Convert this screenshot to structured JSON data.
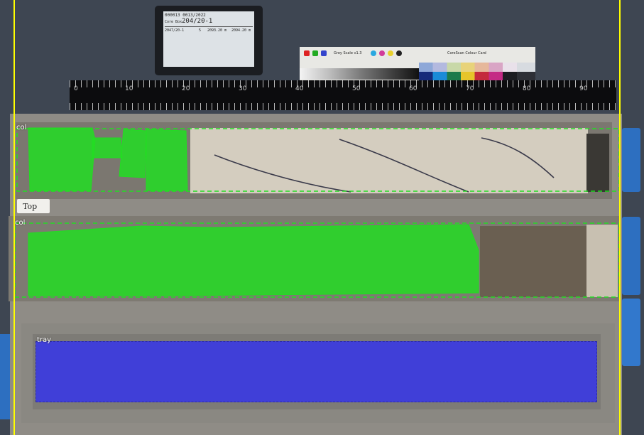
{
  "colors": {
    "background": "#3e4652",
    "column_mask": "#22dd22",
    "tray_mask": "#3333ee",
    "boundary_line": "#ffff00"
  },
  "tablet": {
    "header": "000013    0013/2022",
    "core_id": "204/20-1",
    "sub_label": "Core Box",
    "row_left": "2047/20-1",
    "row_mid": "5",
    "row_depth_top": "2093.20 m",
    "row_depth_bottom": "2094.20 m"
  },
  "scale_card": {
    "rgb": [
      "R",
      "G",
      "B"
    ],
    "grey_label": "Grey Scale v1.3",
    "cmyk": [
      "C",
      "M",
      "Y",
      "K"
    ],
    "footer": "CoreScan Colour Card"
  },
  "ruler": {
    "numbers": [
      "0",
      "10",
      "20",
      "30",
      "40",
      "50",
      "60",
      "70",
      "80",
      "90"
    ]
  },
  "sticker": {
    "text": "Top"
  },
  "annotations": [
    {
      "label": "col"
    },
    {
      "label": "col"
    },
    {
      "label": "tray"
    }
  ]
}
